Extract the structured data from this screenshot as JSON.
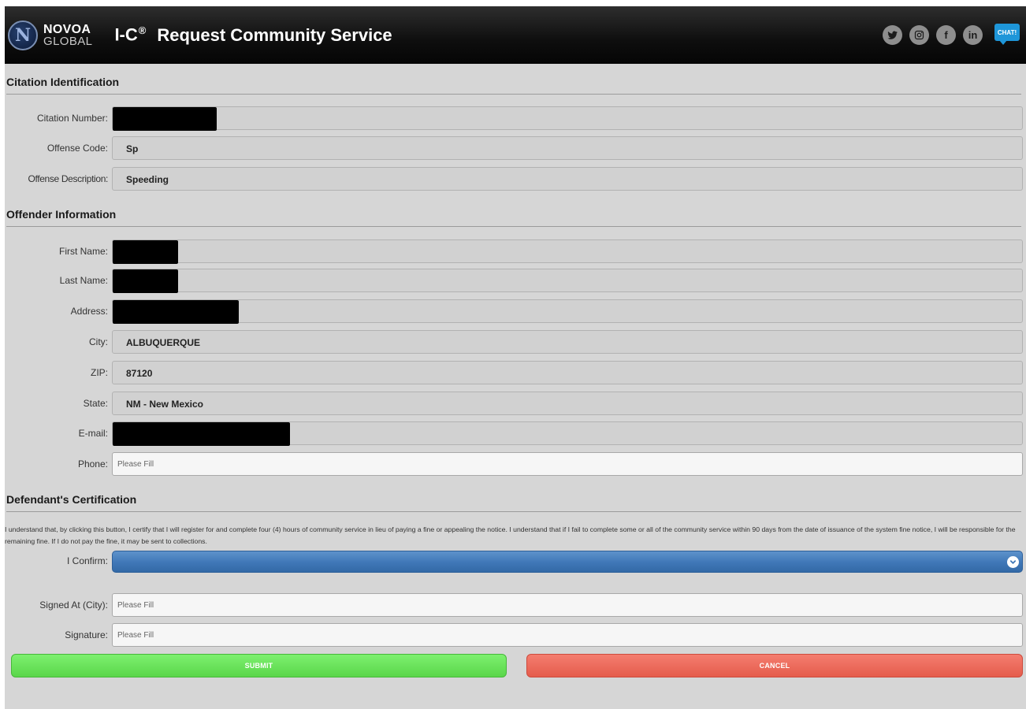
{
  "header": {
    "logo_line1": "NOVOA",
    "logo_line2": "GLOBAL",
    "app_name": "I-C",
    "app_mark": "®",
    "page_title": "Request Community Service",
    "social": {
      "facebook": "f",
      "linkedin": "in"
    },
    "chat_label": "CHAT!"
  },
  "citation": {
    "heading": "Citation Identification",
    "citation_number_label": "Citation Number:",
    "offense_code_label": "Offense Code:",
    "offense_code": "Sp",
    "offense_description_label": "Offense Description:",
    "offense_description": "Speeding"
  },
  "offender": {
    "heading": "Offender Information",
    "first_name_label": "First Name:",
    "last_name_label": "Last Name:",
    "address_label": "Address:",
    "city_label": "City:",
    "city": "ALBUQUERQUE",
    "zip_label": "ZIP:",
    "zip": "87120",
    "state_label": "State:",
    "state": "NM - New Mexico",
    "email_label": "E-mail:",
    "phone_label": "Phone:",
    "phone_placeholder": "Please Fill"
  },
  "certification": {
    "heading": "Defendant's Certification",
    "text": "I understand that, by clicking this button, I certify that I will register for and complete four (4) hours of community service in lieu of paying a fine or appealing the notice. I understand that if I fail to complete some or all of the community service within 90 days from the date of issuance of the system fine notice, I will be responsible for the remaining fine. If I do not pay the fine, it may be sent to collections.",
    "confirm_label": "I Confirm:",
    "confirm_value": "",
    "signed_at_label": "Signed At (City):",
    "signed_at_placeholder": "Please Fill",
    "signature_label": "Signature:",
    "signature_placeholder": "Please Fill"
  },
  "actions": {
    "submit_label": "SUBMIT",
    "cancel_label": "CANCEL"
  },
  "colors": {
    "header_bg": "#0e0e0e",
    "page_bg": "#d6d6d6",
    "select_blue": "#3f77b7",
    "submit_green": "#5ad64a",
    "cancel_red": "#e55c4c",
    "chat_blue": "#1e96d9"
  }
}
